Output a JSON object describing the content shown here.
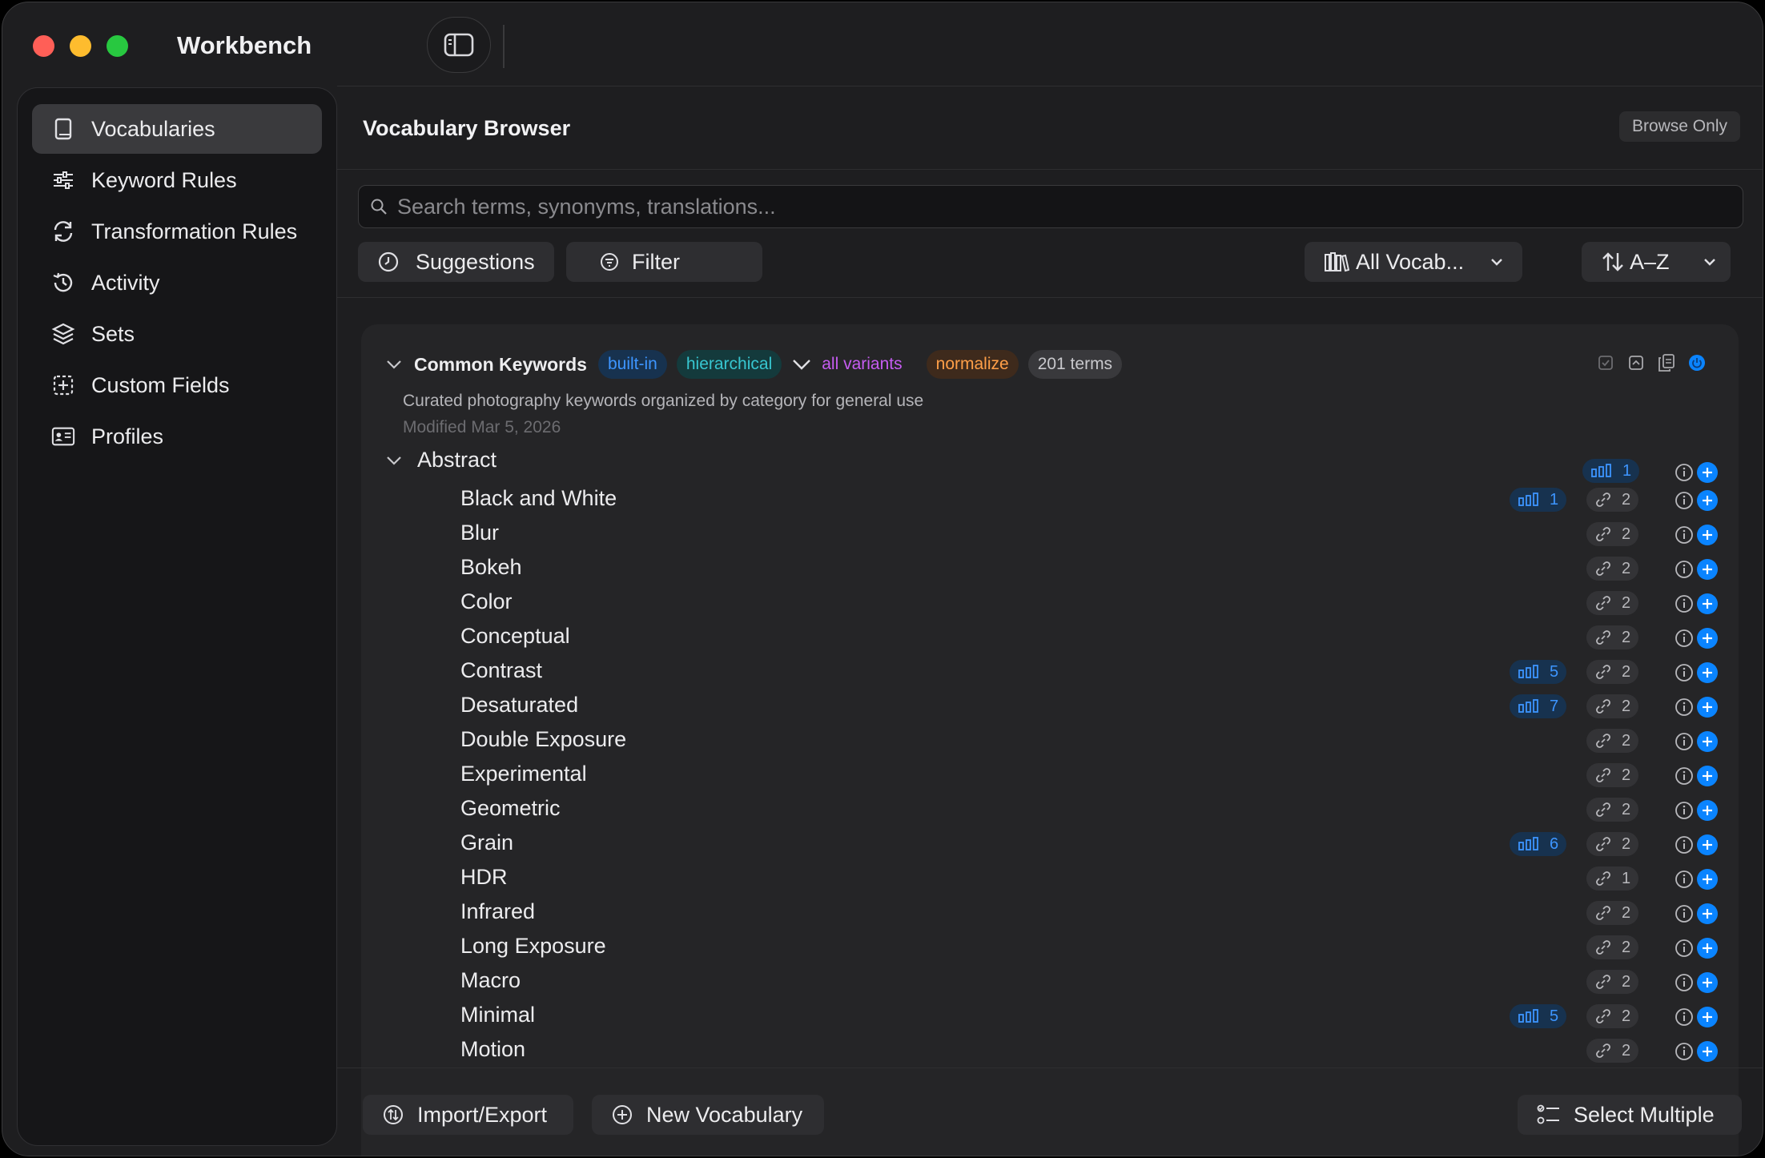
{
  "window": {
    "title": "Workbench"
  },
  "sidebar": {
    "items": [
      {
        "label": "Vocabularies",
        "icon": "book-icon",
        "active": true
      },
      {
        "label": "Keyword Rules",
        "icon": "sliders-icon",
        "active": false
      },
      {
        "label": "Transformation Rules",
        "icon": "refresh-icon",
        "active": false
      },
      {
        "label": "Activity",
        "icon": "history-icon",
        "active": false
      },
      {
        "label": "Sets",
        "icon": "layers-icon",
        "active": false
      },
      {
        "label": "Custom Fields",
        "icon": "add-field-icon",
        "active": false
      },
      {
        "label": "Profiles",
        "icon": "id-card-icon",
        "active": false
      }
    ]
  },
  "main": {
    "title": "Vocabulary Browser",
    "mode_badge": "Browse Only",
    "search": {
      "placeholder": "Search terms, synonyms, translations...",
      "value": ""
    },
    "toolbar": {
      "suggestions": "Suggestions",
      "filter": "Filter",
      "vocab_select": "All Vocab...",
      "sort_select": "A–Z"
    }
  },
  "vocabulary": {
    "name": "Common Keywords",
    "tags": {
      "builtin": "built-in",
      "hierarchical": "hierarchical",
      "variants": "all variants",
      "normalize": "normalize",
      "count": "201 terms"
    },
    "description": "Curated photography keywords organized by category for general use",
    "modified": "Modified Mar 5, 2026",
    "group": {
      "label": "Abstract",
      "usage": "1"
    },
    "terms": [
      {
        "label": "Black and White",
        "usage": "1",
        "links": "2"
      },
      {
        "label": "Blur",
        "usage": null,
        "links": "2"
      },
      {
        "label": "Bokeh",
        "usage": null,
        "links": "2"
      },
      {
        "label": "Color",
        "usage": null,
        "links": "2"
      },
      {
        "label": "Conceptual",
        "usage": null,
        "links": "2"
      },
      {
        "label": "Contrast",
        "usage": "5",
        "links": "2"
      },
      {
        "label": "Desaturated",
        "usage": "7",
        "links": "2"
      },
      {
        "label": "Double Exposure",
        "usage": null,
        "links": "2"
      },
      {
        "label": "Experimental",
        "usage": null,
        "links": "2"
      },
      {
        "label": "Geometric",
        "usage": null,
        "links": "2"
      },
      {
        "label": "Grain",
        "usage": "6",
        "links": "2"
      },
      {
        "label": "HDR",
        "usage": null,
        "links": "1"
      },
      {
        "label": "Infrared",
        "usage": null,
        "links": "2"
      },
      {
        "label": "Long Exposure",
        "usage": null,
        "links": "2"
      },
      {
        "label": "Macro",
        "usage": null,
        "links": "2"
      },
      {
        "label": "Minimal",
        "usage": "5",
        "links": "2"
      },
      {
        "label": "Motion",
        "usage": null,
        "links": "2"
      }
    ]
  },
  "footer": {
    "import_export": "Import/Export",
    "new_vocabulary": "New Vocabulary",
    "select_multiple": "Select Multiple"
  },
  "colors": {
    "accent": "#0a84ff",
    "usage_text": "#3d95ff",
    "window_bg": "#1e1e20",
    "sidebar_bg": "#161618"
  }
}
